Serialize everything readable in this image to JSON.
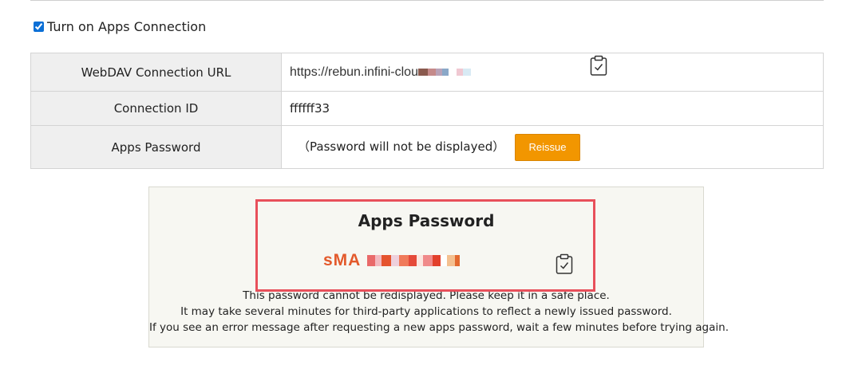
{
  "settings": {
    "apps_connection_label": "Turn on Apps Connection",
    "apps_connection_checked": true
  },
  "connection_table": {
    "rows": [
      {
        "key": "WebDAV Connection URL",
        "value": "https://rebun.infini-clou"
      },
      {
        "key": "Connection ID",
        "value": "ffffff33"
      },
      {
        "key": "Apps Password",
        "value": "（Password will not be displayed）"
      }
    ],
    "reissue_label": "Reissue"
  },
  "password_panel": {
    "title": "Apps Password",
    "password_visible_prefix": "sMA",
    "notes": [
      "This password cannot be redisplayed. Please keep it in a safe place.",
      "It may take several minutes for third-party applications to reflect a newly issued password.",
      "If you see an error message after requesting a new apps password, wait a few minutes before trying again."
    ]
  },
  "colors": {
    "accent_orange": "#f29600",
    "highlight_red": "#e8505b",
    "password_text": "#e35a2c"
  },
  "icons": {
    "copy": "clipboard-check-icon"
  }
}
